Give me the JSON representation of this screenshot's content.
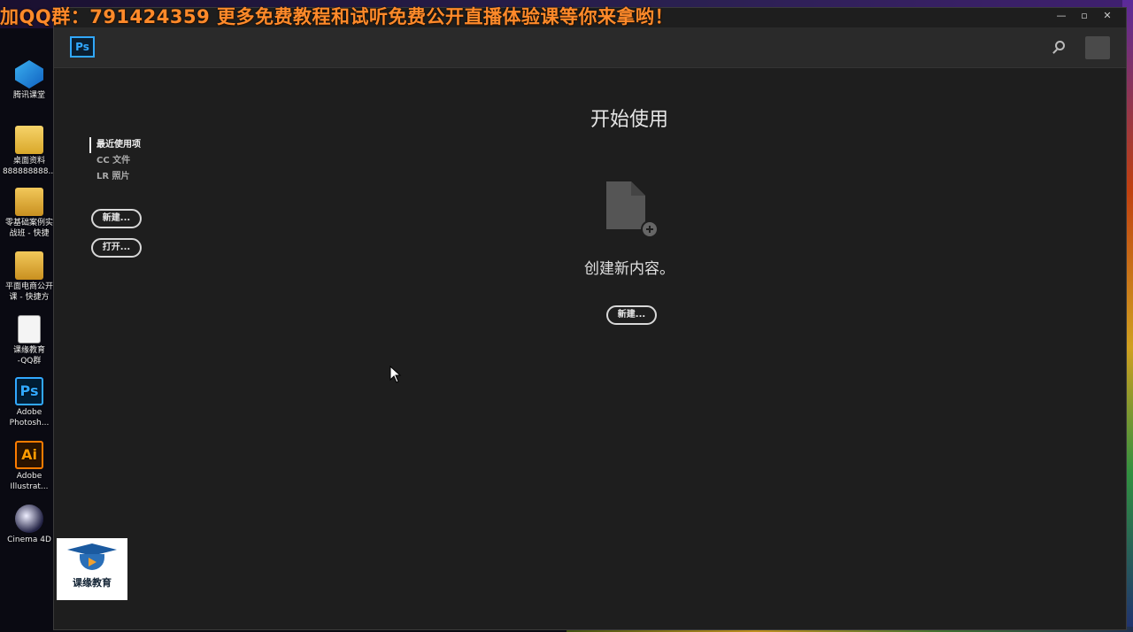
{
  "banner": {
    "text": "加QQ群：791424359 更多免费教程和试听免费公开直播体验课等你来拿哟！"
  },
  "desktop": {
    "icons": [
      {
        "label_line1": "腾讯课堂",
        "label_line2": "",
        "icon": "tencent-classroom-icon"
      },
      {
        "label_line1": "桌面资料",
        "label_line2": "888888888...",
        "icon": "folder-icon"
      },
      {
        "label_line1": "零基础案例实",
        "label_line2": "战班 - 快捷",
        "icon": "folder-icon"
      },
      {
        "label_line1": "平面电商公开",
        "label_line2": "课 - 快捷方",
        "icon": "folder-icon"
      },
      {
        "label_line1": "课缘教育",
        "label_line2": "-QQ群",
        "icon": "text-document-icon"
      },
      {
        "label_line1": "Adobe",
        "label_line2": "Photosh...",
        "icon": "photoshop-icon",
        "glyph": "Ps"
      },
      {
        "label_line1": "Adobe",
        "label_line2": "Illustrat...",
        "icon": "illustrator-icon",
        "glyph": "Ai"
      },
      {
        "label_line1": "Cinema 4D",
        "label_line2": "",
        "icon": "cinema4d-icon"
      }
    ]
  },
  "watermark": {
    "name": "课缘教育"
  },
  "window": {
    "controls": {
      "minimize": "—",
      "maximize": "▫",
      "close": "✕"
    },
    "app_logo": "Ps"
  },
  "sidebar": {
    "items": [
      {
        "label": "最近使用项",
        "active": true
      },
      {
        "label": "CC 文件",
        "active": false
      },
      {
        "label": "LR 照片",
        "active": false
      }
    ],
    "new_button": "新建...",
    "open_button": "打开..."
  },
  "main": {
    "title": "开始使用",
    "subtitle": "创建新内容。",
    "new_button": "新建..."
  },
  "colors": {
    "ps_blue": "#31a8ff",
    "ai_orange": "#ff7c00",
    "banner_orange": "#ff8a2a",
    "window_bg": "#1e1e1e",
    "header_bg": "#2a2a2a"
  }
}
